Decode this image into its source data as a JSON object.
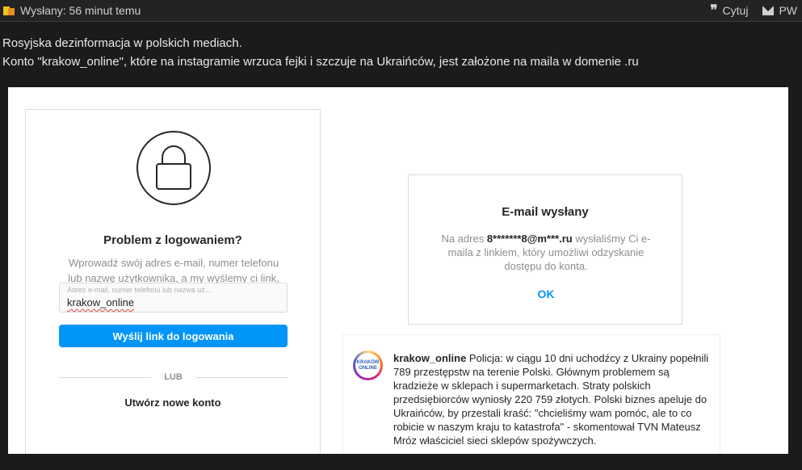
{
  "header": {
    "sent_label": "Wysłany: 56 minut temu",
    "quote_label": "Cytuj",
    "pm_label": "PW"
  },
  "post": {
    "line1": "Rosyjska dezinformacja w polskich mediach.",
    "line2": "Konto \"krakow_online\", które na instagramie wrzuca fejki i szczuje na Ukraińców, jest założone na maila w domenie .ru"
  },
  "login": {
    "title": "Problem z logowaniem?",
    "description": "Wprowadź swój adres e-mail, numer telefonu lub nazwę użytkownika, a my wyślemy ci link, który umożliwi odzyskanie dostępu do konta.",
    "input_placeholder": "Adres e-mail, numer telefonu lub nazwa uż...",
    "input_value": "krakow_online",
    "send_button": "Wyślij link do logowania",
    "or_label": "LUB",
    "create_account": "Utwórz nowe konto"
  },
  "email_sent": {
    "title": "E-mail wysłany",
    "desc_prefix": "Na adres ",
    "email": "8*******8@m***.ru",
    "desc_suffix": " wysłaliśmy Ci e-maila z linkiem, który umożliwi odzyskanie dostępu do konta.",
    "ok_label": "OK"
  },
  "ig_post": {
    "avatar_text": "KRAKÓW ONLINE",
    "username": "krakow_online",
    "caption": " Policja: w ciągu 10 dni uchodźcy z Ukrainy popełnili 789 przestępstw na terenie Polski. Głównym problemem są kradzieże w sklepach i supermarketach. Straty polskich przedsiębiorców wyniosły 220 759 złotych. Polski biznes apeluje do Ukraińców, by przestali kraść: \"chcieliśmy wam pomóc, ale to co robicie w naszym kraju to katastrofa\" - skomentował TVN Mateusz Mróz właściciel sieci sklepów spożywczych."
  }
}
